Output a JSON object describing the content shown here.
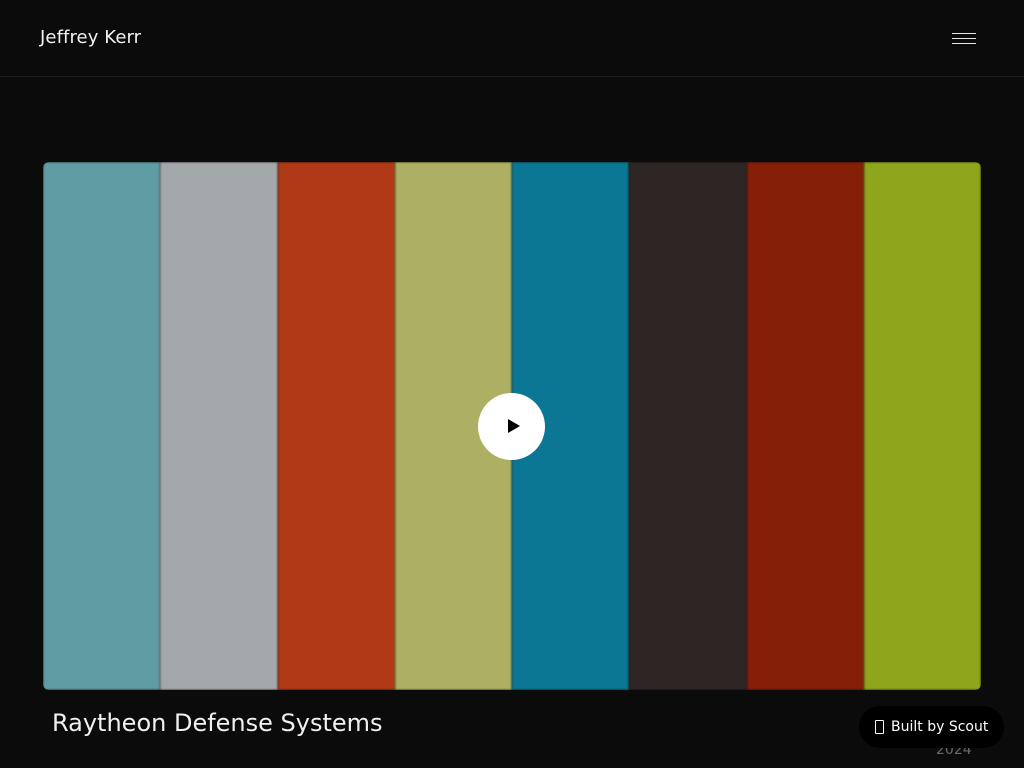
{
  "header": {
    "site_title": "Jeffrey Kerr",
    "menu_icon": "hamburger-menu-icon"
  },
  "video": {
    "stripe_colors": [
      "#5f9ca3",
      "#a3a8ab",
      "#b03a18",
      "#adb062",
      "#0b7794",
      "#2e2624",
      "#861f07",
      "#8ea51c"
    ],
    "play_icon": "play-icon"
  },
  "project": {
    "title": "Raytheon Defense Systems",
    "year": "2024"
  },
  "badge": {
    "icon": "scout-icon",
    "label": "Built by Scout"
  }
}
